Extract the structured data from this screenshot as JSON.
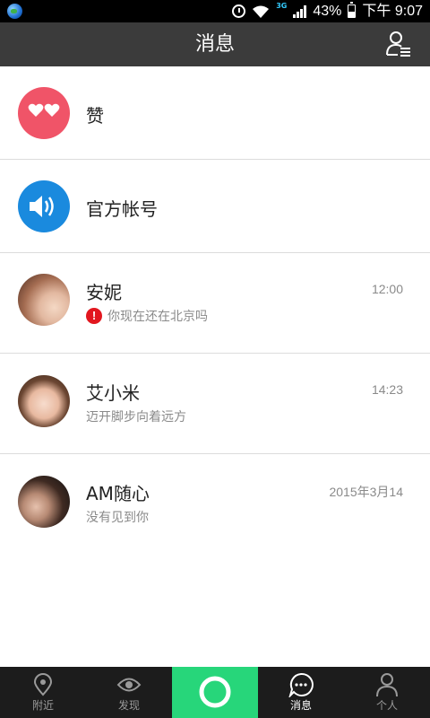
{
  "status_bar": {
    "network": "3G",
    "battery": "43%",
    "time": "下午 9:07",
    "battery_level": 0.43
  },
  "header": {
    "title": "消息",
    "contacts_icon": "contacts-list-icon"
  },
  "conversations": [
    {
      "name": "赞",
      "icon": "heart-eyes-icon",
      "color": "#f05468"
    },
    {
      "name": "官方帐号",
      "icon": "speaker-icon",
      "color": "#1a8ade"
    },
    {
      "name": "安妮",
      "time": "12:00",
      "message": "你现在还在北京吗",
      "status": "failed",
      "status_icon": "exclamation-icon"
    },
    {
      "name": "艾小米",
      "time": "14:23",
      "message": "迈开脚步向着远方"
    },
    {
      "name": "AM随心",
      "time": "2015年3月14",
      "message": "没有见到你"
    }
  ],
  "tab_bar": {
    "tabs": [
      {
        "label": "附近",
        "icon": "location-pin-icon"
      },
      {
        "label": "发现",
        "icon": "eye-icon"
      },
      {
        "label": "",
        "icon": "camera-ring-icon",
        "color": "#27d67a"
      },
      {
        "label": "消息",
        "icon": "chat-bubble-icon",
        "active": true
      },
      {
        "label": "个人",
        "icon": "person-icon"
      }
    ]
  }
}
